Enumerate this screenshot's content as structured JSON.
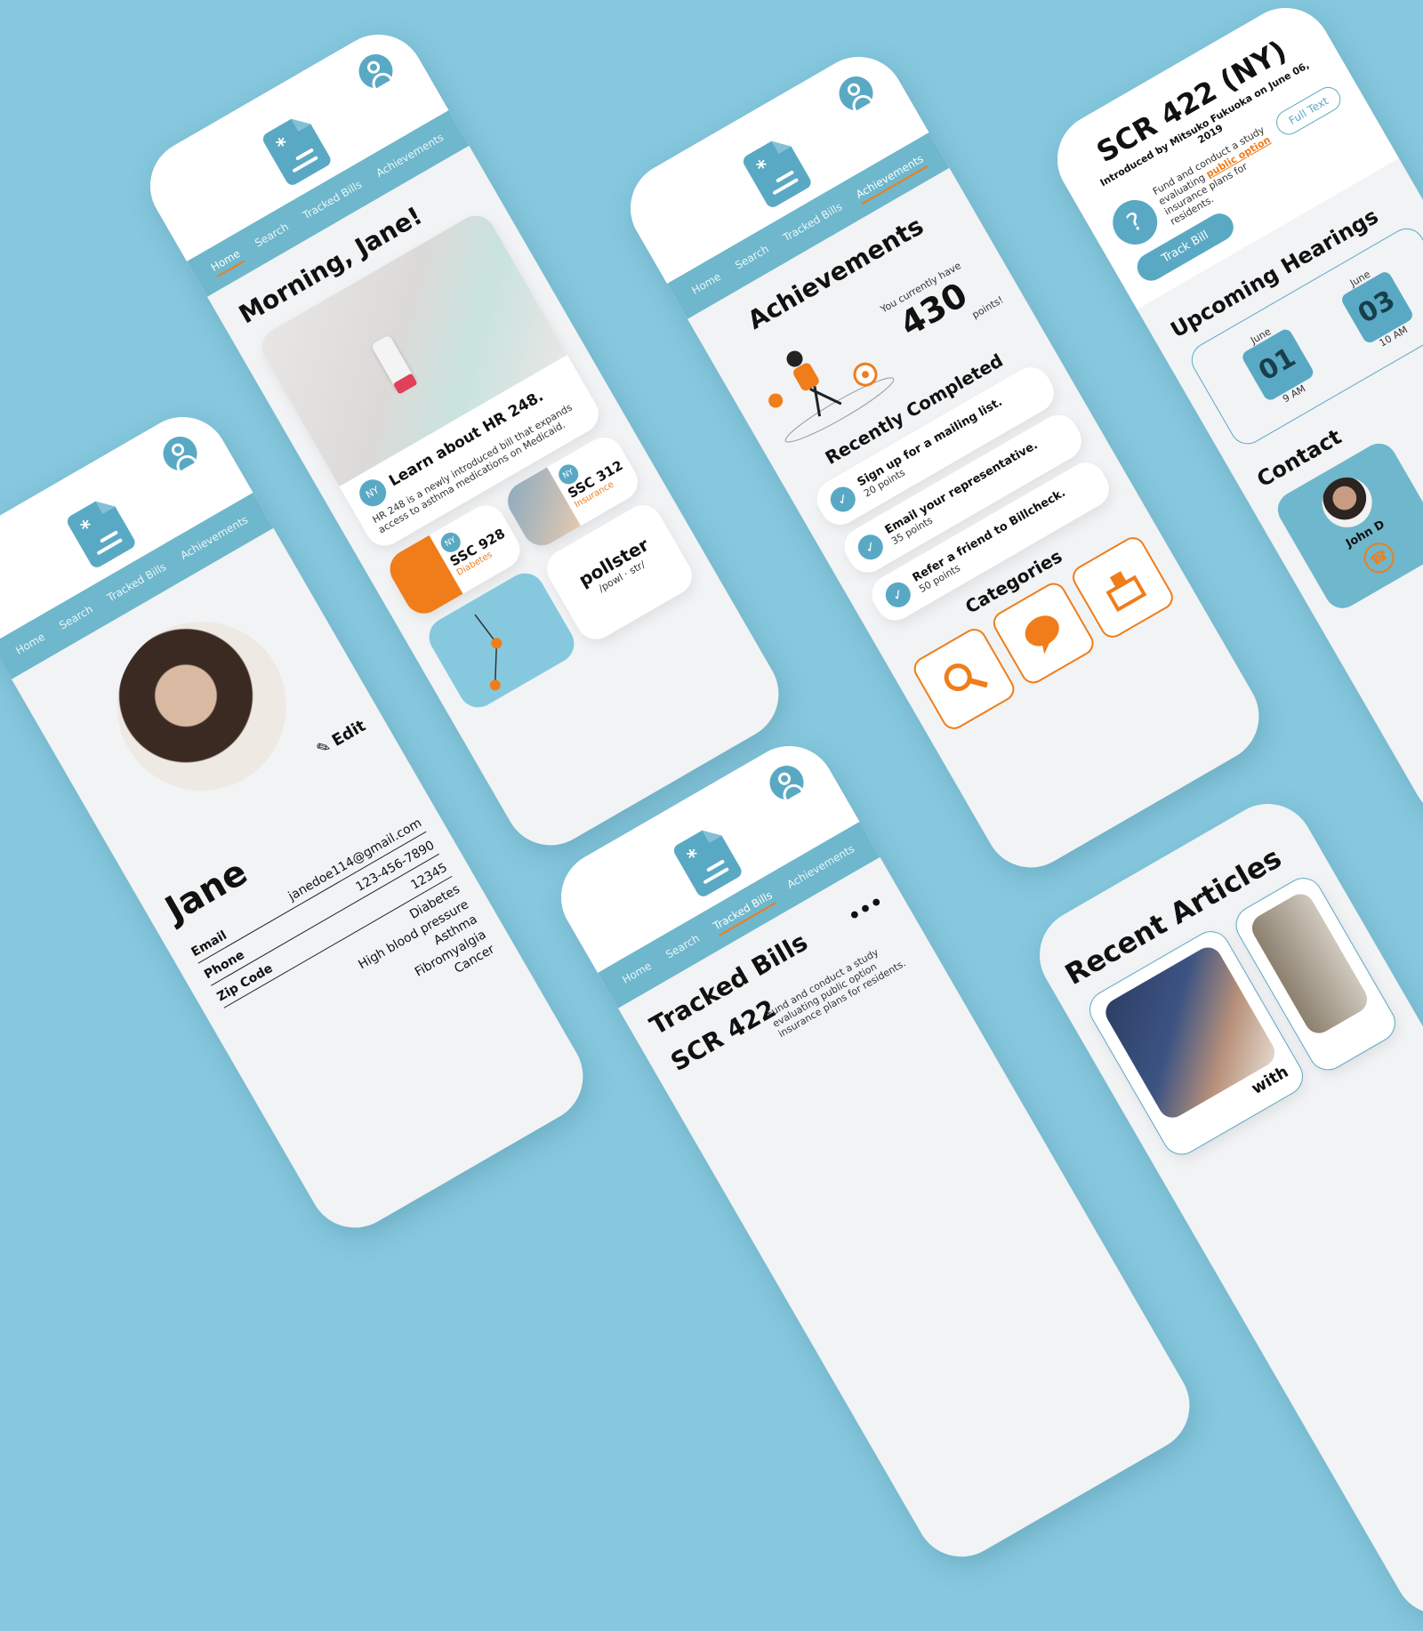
{
  "nav": {
    "home": "Home",
    "search": "Search",
    "tracked_bills": "Tracked Bills",
    "achievements": "Achievements"
  },
  "profile": {
    "name": "Jane",
    "edit_label": "Edit",
    "email_label": "Email",
    "email": "janedoe114@gmail.com",
    "phone_label": "Phone",
    "phone": "123-456-7890",
    "zip_label": "Zip Code",
    "zip": "12345",
    "conditions": [
      "Diabetes",
      "High blood pressure",
      "Asthma",
      "Fibromyalgia",
      "Cancer"
    ]
  },
  "home": {
    "greeting": "Morning, Jane!",
    "feature": {
      "badge": "NY",
      "title": "Learn about HR 248.",
      "desc": "HR 248 is a newly introduced bill that expands access to asthma medications on Medicaid."
    },
    "bill1": {
      "badge": "NY",
      "id": "SSC 312",
      "tag": "Insurance"
    },
    "bill2": {
      "badge": "NY",
      "id": "SSC 928",
      "tag": "Diabetes"
    },
    "word": {
      "term": "pollster",
      "pron": "/powl · str/"
    }
  },
  "achievements": {
    "title": "Achievements",
    "points_prefix": "You currently have",
    "points": "430",
    "points_suffix": "points!",
    "recent_title": "Recently Completed",
    "items": [
      {
        "title": "Sign up for a mailing list.",
        "points": "20 points"
      },
      {
        "title": "Email your representative.",
        "points": "35 points"
      },
      {
        "title": "Refer a friend to Billcheck.",
        "points": "50 points"
      }
    ],
    "categories_title": "Categories"
  },
  "tracked": {
    "title": "Tracked Bills",
    "bill_id": "SCR 422",
    "bill_desc": "Fund and conduct a study evaluating public option insurance plans for residents."
  },
  "bill_detail": {
    "title": "SCR 422 (NY)",
    "intro": "Introduced by Mitsuko Fukuoka on June 06, 2019",
    "desc_before": "Fund and conduct a study evaluating ",
    "desc_highlight": "public option",
    "desc_after": " insurance plans for residents.",
    "full_text": "Full Text",
    "track_bill": "Track Bill",
    "hearings_title": "Upcoming Hearings",
    "hearings": [
      {
        "month": "June",
        "day": "01",
        "time": "9 AM"
      },
      {
        "month": "June",
        "day": "03",
        "time": "10 AM"
      }
    ],
    "contact_title": "Contact",
    "contact_name": "John D"
  },
  "articles": {
    "title": "Recent Articles",
    "caption": "with"
  },
  "colors": {
    "background": "#86c9df",
    "accent": "#5aa9c4",
    "nav": "#6fb7cc",
    "highlight": "#f07d1a"
  }
}
